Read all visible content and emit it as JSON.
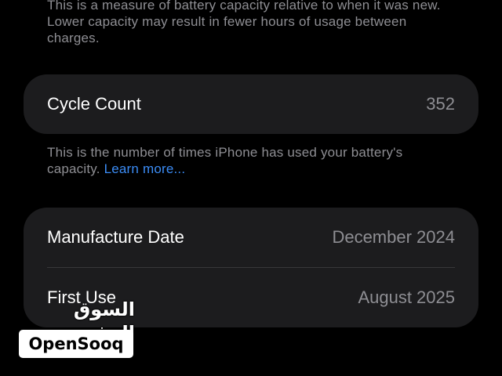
{
  "capacity_footnote": "This is a measure of battery capacity relative to when it was new. Lower capacity may result in fewer hours of usage between charges.",
  "cycle_count": {
    "label": "Cycle Count",
    "value": "352"
  },
  "cycle_footnote": {
    "text": "This is the number of times iPhone has used your battery's capacity. ",
    "link": "Learn more..."
  },
  "dates": {
    "manufacture_label": "Manufacture Date",
    "manufacture_value": "December 2024",
    "first_use_label": "First Use",
    "first_use_value": "August 2025"
  },
  "watermark": {
    "arabic": "السوق المفتوح",
    "brand": "OpenSooq"
  },
  "colors": {
    "background": "#000000",
    "card": "#1c1c1e",
    "secondary_text": "#8e8e93",
    "link": "#3b8cf5"
  }
}
